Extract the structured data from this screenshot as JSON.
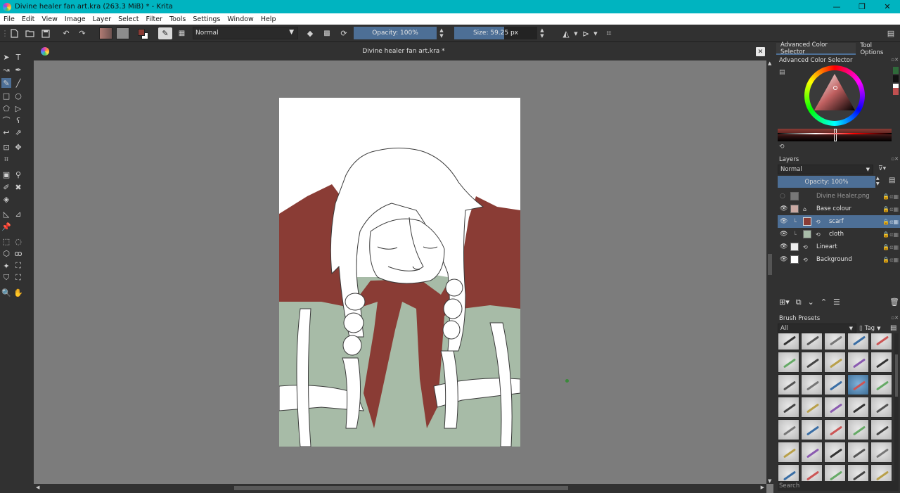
{
  "window": {
    "title": "Divine healer fan art.kra (263.3 MiB)  * - Krita",
    "minimize": "—",
    "maximize": "❐",
    "close": "✕"
  },
  "menu": [
    "File",
    "Edit",
    "View",
    "Image",
    "Layer",
    "Select",
    "Filter",
    "Tools",
    "Settings",
    "Window",
    "Help"
  ],
  "toolbar": {
    "blend_mode": "Normal",
    "opacity_label": "Opacity: 100%",
    "opacity_value": 1.0,
    "size_label": "Size: 59.25 px",
    "size_fraction": 0.6,
    "foreground_color": "#8a3c35",
    "background_color": "#ffffff"
  },
  "document": {
    "tab_title": "Divine healer fan art.kra *",
    "close": "✕"
  },
  "dock": {
    "tabs": [
      "Advanced Color Selector",
      "Tool Options"
    ],
    "color_selector_title": "Advanced Color Selector",
    "layers_title": "Layers",
    "layers_blend": "Normal",
    "layers_opacity": "Opacity:  100%",
    "layers": [
      {
        "name": "Divine Healer.png",
        "visible": false,
        "selected": false,
        "indent": 0,
        "thumb": "#777777"
      },
      {
        "name": "Base colour",
        "visible": true,
        "selected": false,
        "indent": 0,
        "thumb": "#c9a9a3"
      },
      {
        "name": "scarf",
        "visible": true,
        "selected": true,
        "indent": 1,
        "thumb": "#8a3c35"
      },
      {
        "name": "cloth",
        "visible": true,
        "selected": false,
        "indent": 1,
        "thumb": "#a9bca9"
      },
      {
        "name": "Lineart",
        "visible": true,
        "selected": false,
        "indent": 0,
        "thumb": "#eeeeee"
      },
      {
        "name": "Background",
        "visible": true,
        "selected": false,
        "indent": 0,
        "thumb": "#ffffff"
      }
    ],
    "brush_presets_title": "Brush Presets",
    "brush_filter": "All",
    "tag_label": "Tag",
    "search_label": "Search"
  }
}
